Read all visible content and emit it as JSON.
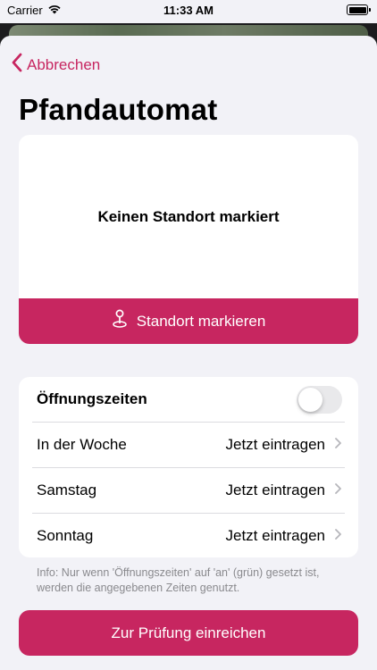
{
  "status_bar": {
    "carrier": "Carrier",
    "time": "11:33 AM"
  },
  "nav": {
    "back_label": "Abbrechen"
  },
  "page": {
    "title": "Pfandautomat"
  },
  "map": {
    "empty_text": "Keinen Standort markiert",
    "button_label": "Standort markieren"
  },
  "settings": {
    "hours_toggle_label": "Öffnungszeiten",
    "hours_toggle_on": false,
    "rows": [
      {
        "label": "In der Woche",
        "value": "Jetzt eintragen"
      },
      {
        "label": "Samstag",
        "value": "Jetzt eintragen"
      },
      {
        "label": "Sonntag",
        "value": "Jetzt eintragen"
      }
    ]
  },
  "info_text": "Info: Nur wenn 'Öffnungszeiten' auf 'an' (grün) gesetzt ist, werden die angegebenen Zeiten genutzt.",
  "submit_label": "Zur Prüfung einreichen",
  "colors": {
    "accent": "#c72660",
    "background": "#f2f2f7",
    "card": "#ffffff",
    "secondary_text": "#8a8a8e"
  },
  "icons": {
    "back": "chevron-left-icon",
    "location": "location-pin-icon",
    "disclosure": "chevron-right-icon",
    "wifi": "wifi-icon",
    "battery": "battery-icon"
  }
}
